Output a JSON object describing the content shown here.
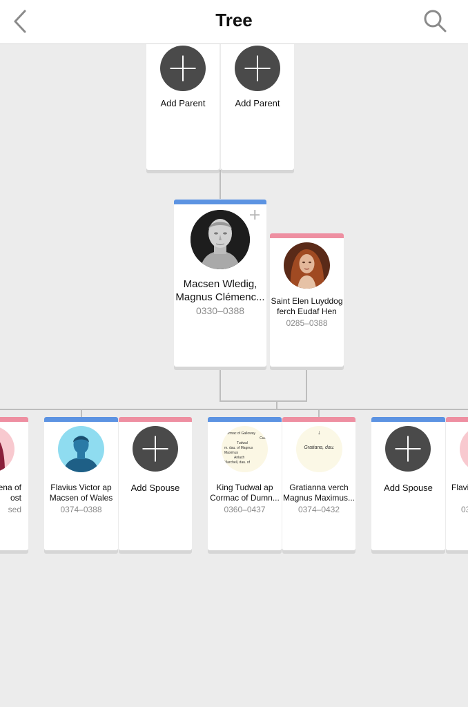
{
  "header": {
    "title": "Tree"
  },
  "parents": [
    {
      "label": "Add Parent"
    },
    {
      "label": "Add Parent"
    }
  ],
  "focus": {
    "name_line1": "Macsen Wledig,",
    "name_line2": "Magnus Clémenc...",
    "dates": "0330–0388"
  },
  "spouse": {
    "name_line1": "Saint Elen Luyddog",
    "name_line2": "ferch Eudaf Hen",
    "dates": "0285–0388"
  },
  "children": {
    "partial_left": {
      "name_line1": "ena of",
      "name_line2": "ost",
      "dates": "sed"
    },
    "flavius": {
      "name_line1": "Flavius Victor ap",
      "name_line2": "Macsen of Wales",
      "dates": "0374–0388"
    },
    "add_spouse_1": {
      "label": "Add Spouse"
    },
    "tudwal": {
      "name_line1": "King Tudwal ap",
      "name_line2": "Cormac of Dumn...",
      "dates": "0360–0437"
    },
    "gratianna": {
      "name_line1": "Gratianna verch",
      "name_line2": "Magnus Maximus...",
      "dates": "0374–0432"
    },
    "add_spouse_2": {
      "label": "Add Spouse"
    },
    "partial_right": {
      "name_line1": "Flavi",
      "dates": "03"
    }
  },
  "doc_snippets": {
    "tudwal_doc": [
      "Cormac of Galloway",
      "Cus",
      "Tudwal",
      "m. dau. of Magnus Maximus",
      "Anlach",
      "Marchell, dau. of"
    ],
    "gratianna_doc": [
      "Gratiana, dau."
    ]
  },
  "colors": {
    "male": "#5c93e2",
    "female": "#ee8fa1",
    "add_button": "#4a4a4a"
  }
}
